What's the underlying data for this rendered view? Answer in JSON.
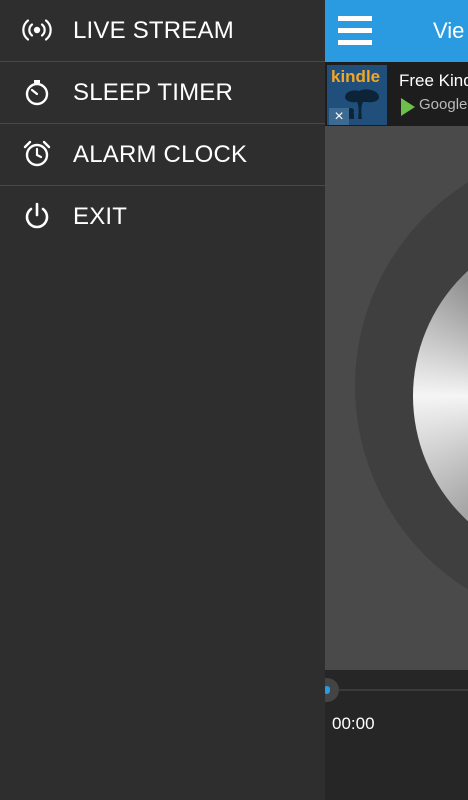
{
  "menu": {
    "items": [
      {
        "label": "LIVE STREAM",
        "icon": "broadcast-icon"
      },
      {
        "label": "SLEEP TIMER",
        "icon": "stopwatch-icon"
      },
      {
        "label": "ALARM CLOCK",
        "icon": "alarm-clock-icon"
      },
      {
        "label": "EXIT",
        "icon": "power-icon"
      }
    ]
  },
  "toolbar": {
    "title": "Vie"
  },
  "ad": {
    "logo_text": "kindle",
    "close_glyph": "×",
    "headline": "Free Kind",
    "store_text": "Google p"
  },
  "player": {
    "elapsed": "00:00"
  },
  "colors": {
    "accent": "#2a9be0",
    "drawer_bg": "#2e2e2e"
  }
}
